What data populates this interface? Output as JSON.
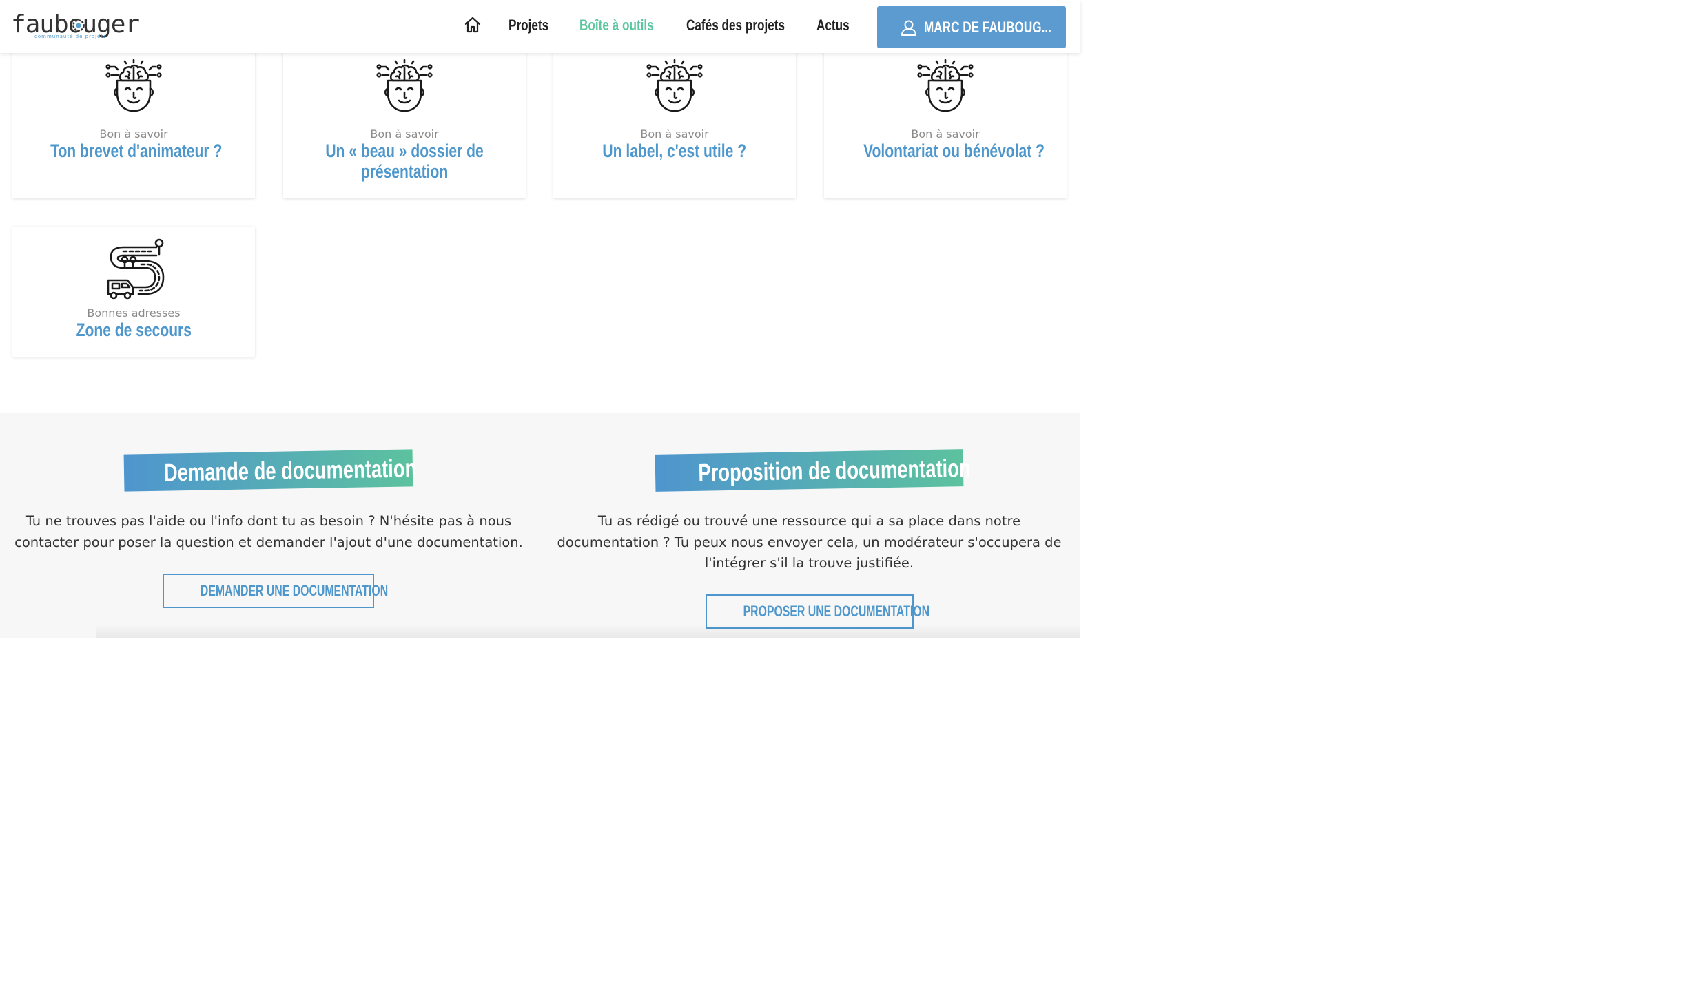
{
  "header": {
    "logo_text": "faubouger",
    "logo_tagline": "communauté de projets",
    "nav": [
      {
        "label": "Projets",
        "active": false
      },
      {
        "label": "Boîte à outils",
        "active": true
      },
      {
        "label": "Cafés des projets",
        "active": false
      },
      {
        "label": "Actus",
        "active": false
      }
    ],
    "user_button_label": "MARC DE FAUBOUG..."
  },
  "cards": [
    {
      "category": "Bon à savoir",
      "title_lines": [
        "Ton brevet d'animateur ?"
      ],
      "icon": "brain-head-icon"
    },
    {
      "category": "Bon à savoir",
      "title_lines": [
        "Un « beau » dossier de",
        "présentation"
      ],
      "icon": "brain-head-icon"
    },
    {
      "category": "Bon à savoir",
      "title_lines": [
        "Un label, c'est utile ?"
      ],
      "icon": "brain-head-icon"
    },
    {
      "category": "Bon à savoir",
      "title_lines": [
        "Volontariat ou bénévolat ?"
      ],
      "icon": "brain-head-icon"
    },
    {
      "category": "Bonnes adresses",
      "title_lines": [
        "Zone de secours"
      ],
      "icon": "road-map-icon"
    }
  ],
  "documentation": {
    "request": {
      "heading": "Demande de documentation",
      "text_lines": [
        "Tu ne trouves pas l'aide ou l'info dont tu as besoin ? N'hésite pas à nous",
        "contacter pour poser la question et demander l'ajout d'une documentation."
      ],
      "button_label": "DEMANDER UNE DOCUMENTATION"
    },
    "proposal": {
      "heading": "Proposition de documentation",
      "text_lines": [
        "Tu as rédigé ou trouvé une ressource qui a sa place dans notre",
        "documentation ? Tu peux nous envoyer cela, un modérateur s'occupera de",
        "l'intégrer s'il la trouve justifiée."
      ],
      "button_label": "PROPOSER UNE DOCUMENTATION"
    }
  },
  "colors": {
    "accent_blue": "#4d97cc",
    "active_green": "#5cc6a0",
    "user_button": "#5b9bd0"
  }
}
